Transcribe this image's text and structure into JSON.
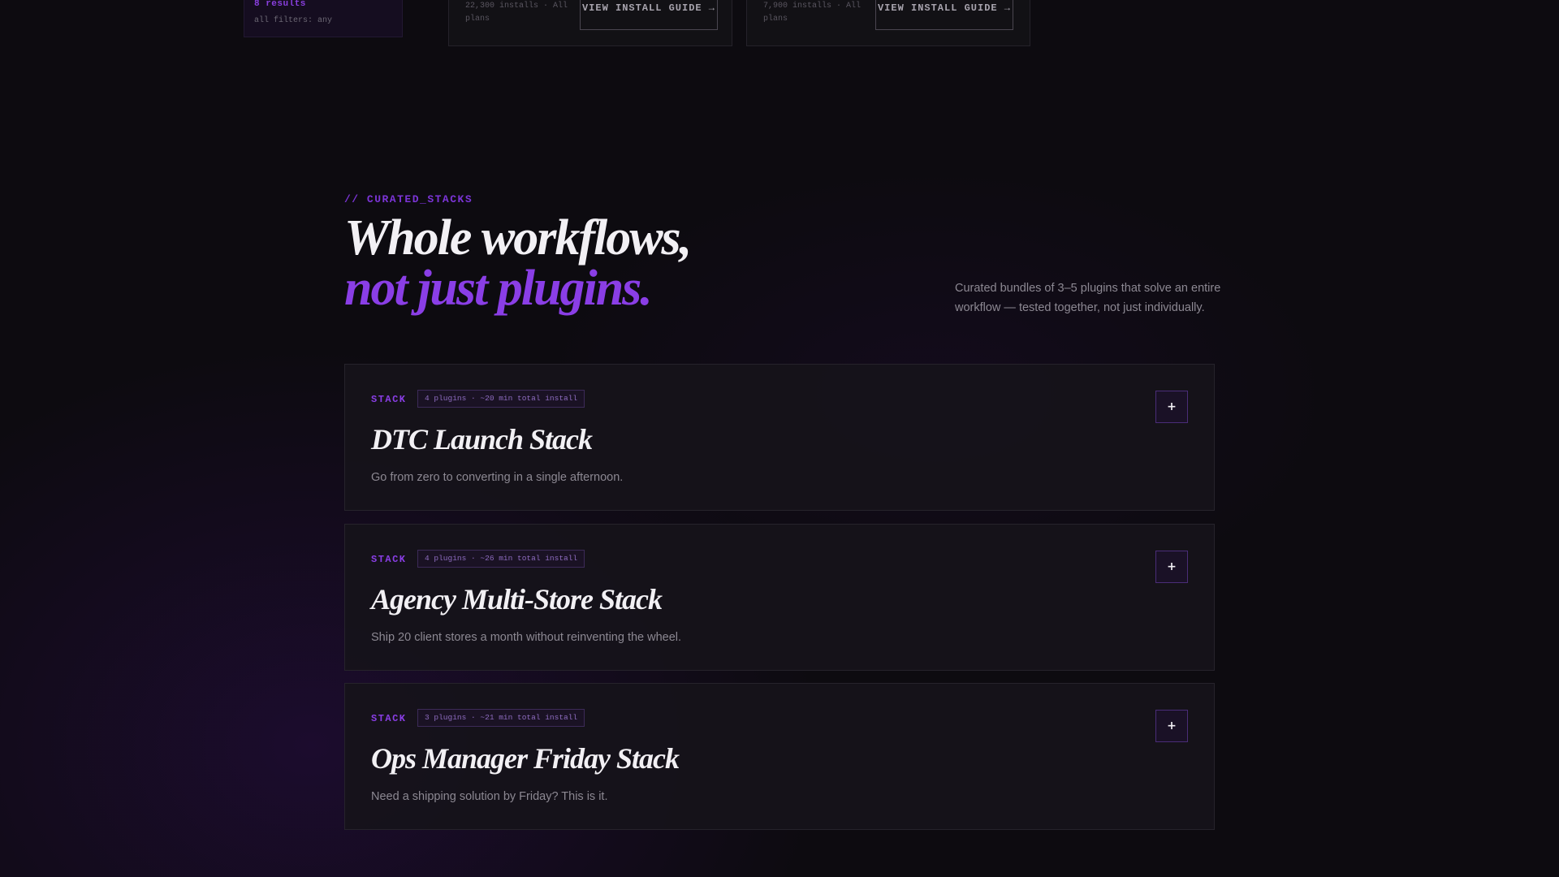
{
  "filters": {
    "results": "8 results",
    "summary": "all filters: any"
  },
  "plugin_cards": [
    {
      "meta": "22,300 installs · All plans",
      "button_label": "VIEW INSTALL GUIDE →"
    },
    {
      "meta": "7,900 installs · All plans",
      "button_label": "VIEW INSTALL GUIDE →"
    }
  ],
  "curated": {
    "eyebrow": "// CURATED_STACKS",
    "headline_line1": "Whole workflows,",
    "headline_line2": "not just plugins.",
    "intro": "Curated bundles of 3–5 plugins that solve an entire workflow — tested together, not just individually.",
    "stacks": [
      {
        "tag": "STACK",
        "meta": "4 plugins · ~20 min total install",
        "title": "DTC Launch Stack",
        "description": "Go from zero to converting in a single afternoon.",
        "expand_label": "+"
      },
      {
        "tag": "STACK",
        "meta": "4 plugins · ~26 min total install",
        "title": "Agency Multi-Store Stack",
        "description": "Ship 20 client stores a month without reinventing the wheel.",
        "expand_label": "+"
      },
      {
        "tag": "STACK",
        "meta": "3 plugins · ~21 min total install",
        "title": "Ops Manager Friday Stack",
        "description": "Need a shipping solution by Friday? This is it.",
        "expand_label": "+"
      }
    ]
  },
  "colors": {
    "background": "#0d0b10",
    "accent": "#8a3ee6",
    "card": "#16141a",
    "muted_text": "#8c8892"
  }
}
